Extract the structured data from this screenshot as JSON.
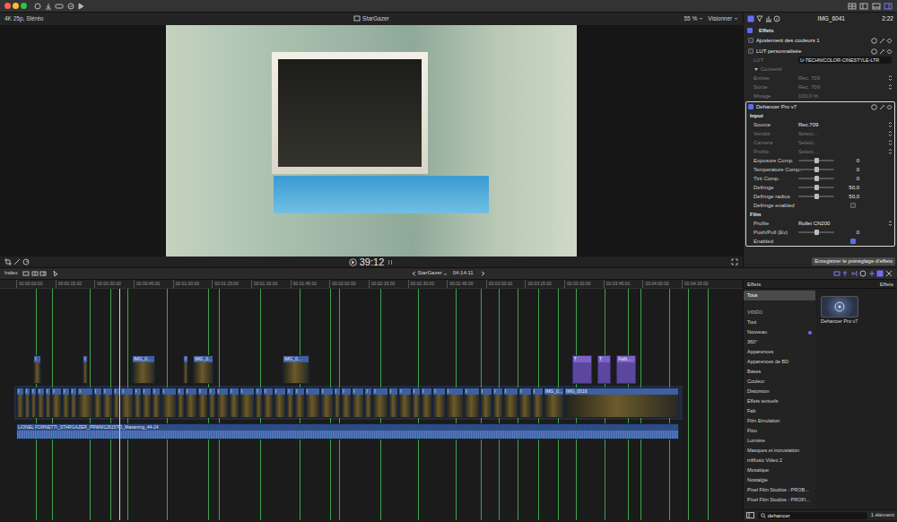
{
  "window": {
    "buttons": [
      {
        "color": "#ff5f57"
      },
      {
        "color": "#febc2e"
      },
      {
        "color": "#28c840"
      }
    ]
  },
  "viewer": {
    "format": "4K 25p, Stéréo",
    "project": "StarGazer",
    "zoom": "55 %",
    "view": "Visionner",
    "timecode": "39:12"
  },
  "inspector": {
    "clip": "IMG_6041",
    "duration": "2:22",
    "title": "Effets",
    "checked": true,
    "effects": [
      {
        "name": "Ajustement des couleurs 1",
        "checked": false,
        "selected": false,
        "rows": []
      },
      {
        "name": "LUT personnalisée",
        "checked": false,
        "selected": false,
        "rows": [
          {
            "kind": "field",
            "label": "LUT",
            "value": "U-TECHNICOLOR-CINESTYLE-LTR",
            "disabled": true
          },
          {
            "kind": "section",
            "label": "Convertir",
            "expanded": true,
            "disabled": true
          },
          {
            "kind": "popup",
            "label": "Entrée",
            "value": "Rec. 709",
            "disabled": true
          },
          {
            "kind": "popup",
            "label": "Sortie",
            "value": "Rec. 709",
            "disabled": true
          },
          {
            "kind": "value",
            "label": "Mixage",
            "value": "100,0 %",
            "disabled": true
          }
        ]
      },
      {
        "name": "Dehancer Pro v7",
        "checked": true,
        "selected": true,
        "rows": [
          {
            "kind": "header",
            "label": "Input"
          },
          {
            "kind": "popup",
            "label": "Source",
            "value": "Rec.709",
            "disabled": false
          },
          {
            "kind": "popup",
            "label": "Vendor",
            "value": "Select...",
            "disabled": true
          },
          {
            "kind": "popup",
            "label": "Camera",
            "value": "Select...",
            "disabled": true
          },
          {
            "kind": "popup",
            "label": "Profile",
            "value": "Select...",
            "disabled": true
          },
          {
            "kind": "slider",
            "label": "Exposure Comp.",
            "value": "0",
            "level": 0.5
          },
          {
            "kind": "slider",
            "label": "Temperature Comp.",
            "value": "0",
            "level": 0.5
          },
          {
            "kind": "slider",
            "label": "Tint Comp.",
            "value": "0",
            "level": 0.5
          },
          {
            "kind": "slider",
            "label": "Defringe",
            "value": "50,0",
            "level": 0.5
          },
          {
            "kind": "slider",
            "label": "Defringe radius",
            "value": "50,0",
            "level": 0.5
          },
          {
            "kind": "checkbox",
            "label": "Defringe enabled",
            "checked": false
          },
          {
            "kind": "header",
            "label": "Film"
          },
          {
            "kind": "popup",
            "label": "Profile",
            "value": "Rollei CN200",
            "disabled": false
          },
          {
            "kind": "slider",
            "label": "Push/Pull (Ev)",
            "value": "0",
            "level": 0.5
          },
          {
            "kind": "checkbox",
            "label": "Enabled",
            "checked": true
          }
        ]
      }
    ]
  },
  "tooltip": "Enregistrer le préréglage d'effets",
  "timeline": {
    "index": "Index",
    "project": "StarGazer",
    "duration": "04:14:11",
    "playhead": 39.5,
    "ruler": [
      "00:00:00:00",
      "00:00:15:00",
      "00:00:30:00",
      "00:00:45:00",
      "00:01:00:00",
      "00:01:15:00",
      "00:01:30:00",
      "00:01:45:00",
      "00:02:00:00",
      "00:02:15:00",
      "00:02:30:00",
      "00:02:45:00",
      "00:03:00:00",
      "00:03:15:00",
      "00:03:30:00",
      "00:03:45:00",
      "00:04:00:00",
      "00:04:15:00"
    ],
    "markers": [
      7.6,
      13.7,
      28.2,
      36.1,
      42.6,
      57.7,
      73.5,
      77.7,
      93.5,
      108.6,
      120.3,
      123.7,
      139.5,
      154,
      168.4,
      178,
      185,
      192,
      200,
      207.6,
      214.4,
      225.4,
      234.4,
      239.2,
      250.2,
      257.5,
      265
    ],
    "connected": [
      {
        "start": 6.5,
        "duration": 3,
        "label": "I",
        "kind": "video"
      },
      {
        "start": 25.4,
        "duration": 2,
        "label": "I",
        "kind": "video"
      },
      {
        "start": 44.3,
        "duration": 9,
        "label": "IMG_0...",
        "kind": "video"
      },
      {
        "start": 64,
        "duration": 2,
        "label": "I",
        "kind": "video"
      },
      {
        "start": 67.7,
        "duration": 8,
        "label": "IMG_0...",
        "kind": "video"
      },
      {
        "start": 102,
        "duration": 10.5,
        "label": "IMG_0...",
        "kind": "video"
      },
      {
        "start": 213,
        "duration": 7.5,
        "label": "T",
        "kind": "title"
      },
      {
        "start": 222.7,
        "duration": 5,
        "label": "T",
        "kind": "title"
      },
      {
        "start": 230,
        "duration": 7.5,
        "label": "Falb...",
        "kind": "title"
      }
    ],
    "storyline": [
      {
        "duration": 3,
        "label": "I"
      },
      {
        "duration": 2.5,
        "label": "I"
      },
      {
        "duration": 2.5,
        "label": "I"
      },
      {
        "duration": 3,
        "label": "I"
      },
      {
        "duration": 2.5,
        "label": "I"
      },
      {
        "duration": 4,
        "label": "I"
      },
      {
        "duration": 3,
        "label": "I"
      },
      {
        "duration": 3,
        "label": "I"
      },
      {
        "duration": 6,
        "label": "I"
      },
      {
        "duration": 3.5,
        "label": "I"
      },
      {
        "duration": 4,
        "label": "I"
      },
      {
        "duration": 3,
        "label": "I"
      },
      {
        "duration": 5,
        "label": "I"
      },
      {
        "duration": 3,
        "label": "I"
      },
      {
        "duration": 4,
        "label": "I"
      },
      {
        "duration": 3.5,
        "label": "I"
      },
      {
        "duration": 6,
        "label": "I"
      },
      {
        "duration": 3,
        "label": "I"
      },
      {
        "duration": 5,
        "label": "I"
      },
      {
        "duration": 4,
        "label": "I"
      },
      {
        "duration": 3,
        "label": "I"
      },
      {
        "duration": 5,
        "label": "I"
      },
      {
        "duration": 4,
        "label": "I"
      },
      {
        "duration": 6,
        "label": "I"
      },
      {
        "duration": 3,
        "label": "I"
      },
      {
        "duration": 4,
        "label": "I"
      },
      {
        "duration": 5,
        "label": "I"
      },
      {
        "duration": 3,
        "label": "I"
      },
      {
        "duration": 4,
        "label": "I"
      },
      {
        "duration": 6,
        "label": "I"
      },
      {
        "duration": 5,
        "label": "I"
      },
      {
        "duration": 3,
        "label": "I"
      },
      {
        "duration": 4,
        "label": "I"
      },
      {
        "duration": 5,
        "label": "I"
      },
      {
        "duration": 3,
        "label": "I"
      },
      {
        "duration": 6,
        "label": "I"
      },
      {
        "duration": 4,
        "label": "I"
      },
      {
        "duration": 5,
        "label": "I"
      },
      {
        "duration": 3.5,
        "label": "I"
      },
      {
        "duration": 4.5,
        "label": "I"
      },
      {
        "duration": 5,
        "label": "I"
      },
      {
        "duration": 7,
        "label": "I"
      },
      {
        "duration": 6,
        "label": "I"
      },
      {
        "duration": 5,
        "label": "I"
      },
      {
        "duration": 4,
        "label": "I"
      },
      {
        "duration": 6,
        "label": "I"
      },
      {
        "duration": 5,
        "label": "I"
      },
      {
        "duration": 4.5,
        "label": "I"
      },
      {
        "duration": 8,
        "label": "IMG_0..."
      },
      {
        "duration": 44,
        "label": "IMG_0016"
      }
    ],
    "audio": {
      "label": "LIONEL FORNETTI_STARGAZER_PRWM12615TO_Mastering_44-24",
      "duration": 254
    }
  },
  "browser": {
    "sidebar_title": "Effets",
    "title": "Effets",
    "categories": [
      {
        "label": "Tous",
        "kind": "item",
        "selected": true,
        "new": false
      },
      {
        "label": "VIDÉO",
        "kind": "heading",
        "selected": false,
        "new": false
      },
      {
        "label": "Tout",
        "kind": "item",
        "selected": false,
        "new": false
      },
      {
        "label": "Nouveau",
        "kind": "item",
        "selected": false,
        "new": true
      },
      {
        "label": "360°",
        "kind": "item",
        "selected": false,
        "new": false
      },
      {
        "label": "Apparences",
        "kind": "item",
        "selected": false,
        "new": false
      },
      {
        "label": "Apparences de BD",
        "kind": "item",
        "selected": false,
        "new": false
      },
      {
        "label": "Bases",
        "kind": "item",
        "selected": false,
        "new": false
      },
      {
        "label": "Couleur",
        "kind": "item",
        "selected": false,
        "new": false
      },
      {
        "label": "Distorsion",
        "kind": "item",
        "selected": false,
        "new": false
      },
      {
        "label": "Effets textuels",
        "kind": "item",
        "selected": false,
        "new": false
      },
      {
        "label": "Fab",
        "kind": "item",
        "selected": false,
        "new": false
      },
      {
        "label": "Film Emulation",
        "kind": "item",
        "selected": false,
        "new": false
      },
      {
        "label": "Flou",
        "kind": "item",
        "selected": false,
        "new": false
      },
      {
        "label": "Lumière",
        "kind": "item",
        "selected": false,
        "new": false
      },
      {
        "label": "Masques et incrustation",
        "kind": "item",
        "selected": false,
        "new": false
      },
      {
        "label": "mMusic Video 2",
        "kind": "item",
        "selected": false,
        "new": false
      },
      {
        "label": "Mosaïque",
        "kind": "item",
        "selected": false,
        "new": false
      },
      {
        "label": "Nostalgie",
        "kind": "item",
        "selected": false,
        "new": false
      },
      {
        "label": "Pixel Film Studios - PROB...",
        "kind": "item",
        "selected": false,
        "new": false
      },
      {
        "label": "Pixel Film Studios - PROFI...",
        "kind": "item",
        "selected": false,
        "new": false
      }
    ],
    "items": [
      {
        "label": "Dehancer Pro v7",
        "selected": false
      }
    ],
    "search": {
      "value": "dehancer"
    },
    "count": "1 élément"
  }
}
